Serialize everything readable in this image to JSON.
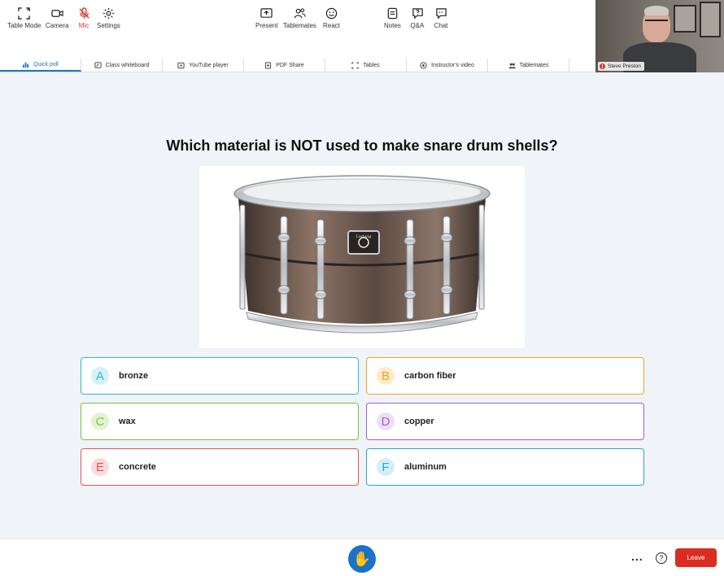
{
  "tabs": [
    {
      "label": "Quick poll",
      "active": true,
      "icon": "poll-icon"
    },
    {
      "label": "Class whiteboard",
      "active": false,
      "icon": "whiteboard-icon"
    },
    {
      "label": "YouTube player",
      "active": false,
      "icon": "play-icon"
    },
    {
      "label": "PDF Share",
      "active": false,
      "icon": "pdf-share-icon"
    },
    {
      "label": "Tables",
      "active": false,
      "icon": "tables-icon"
    },
    {
      "label": "Instructor's video",
      "active": false,
      "icon": "video-icon"
    },
    {
      "label": "Tablemates",
      "active": false,
      "icon": "people-icon"
    }
  ],
  "participant": {
    "name": "Steve Preston",
    "mic_muted": true
  },
  "poll": {
    "question": "Which material is NOT used to make snare drum shells?",
    "image_logo_text": "Ludwig",
    "answers": [
      {
        "letter": "A",
        "text": "bronze",
        "color": "#34b7d6",
        "bg": "#d6f1f7"
      },
      {
        "letter": "B",
        "text": "carbon fiber",
        "color": "#f0a12b",
        "bg": "#fdebc9"
      },
      {
        "letter": "C",
        "text": "wax",
        "color": "#7cc242",
        "bg": "#e4f2d4"
      },
      {
        "letter": "D",
        "text": "copper",
        "color": "#a05ddd",
        "bg": "#eddff9"
      },
      {
        "letter": "E",
        "text": "concrete",
        "color": "#e35353",
        "bg": "#fadada"
      },
      {
        "letter": "F",
        "text": "aluminum",
        "color": "#2aa7c9",
        "bg": "#d4eef6"
      }
    ]
  },
  "toolbar": {
    "table_mode": "Table Mode",
    "camera": "Camera",
    "mic": "Mic",
    "settings": "Settings",
    "present": "Present",
    "tablemates": "Tablemates",
    "react": "React",
    "notes": "Notes",
    "qa": "Q&A",
    "chat": "Chat",
    "more": "...",
    "help": "?",
    "leave": "Leave"
  },
  "colors": {
    "accent": "#1a73c8",
    "leave": "#d92d20",
    "stage_bg": "#f0f3f7"
  }
}
